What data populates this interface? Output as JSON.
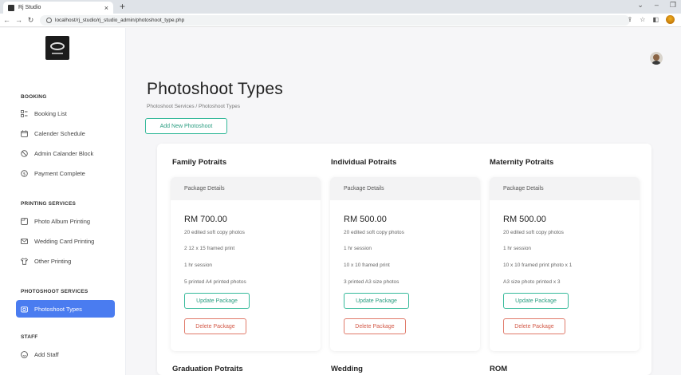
{
  "browser": {
    "tab_title": "Rj Studio",
    "tab_close": "×",
    "new_tab": "+",
    "url": "localhost/rj_studio/rj_studio_admin/photoshoot_type.php"
  },
  "sidebar": {
    "sections": [
      {
        "title": "BOOKING",
        "items": [
          "Booking List",
          "Calender Schedule",
          "Admin Calander Block",
          "Payment Complete"
        ]
      },
      {
        "title": "PRINTING SERVICES",
        "items": [
          "Photo Album Printing",
          "Wedding Card Printing",
          "Other Printing"
        ]
      },
      {
        "title": "PHOTOSHOOT SERVICES",
        "items": [
          "Photoshoot Types"
        ]
      },
      {
        "title": "STAFF",
        "items": [
          "Add Staff"
        ]
      }
    ],
    "active_item": "Photoshoot Types"
  },
  "page": {
    "title": "Photoshoot Types",
    "breadcrumb": "Photoshoot Services  /  Photoshoot Types",
    "add_button": "Add New Photoshoot"
  },
  "packages": [
    {
      "name": "Family Potraits",
      "header": "Package Details",
      "price": "RM 700.00",
      "details": [
        "20 edited soft copy photos",
        "2 12 x 15 framed print",
        "1 hr session",
        "5 printed A4 printed photos"
      ],
      "update": "Update Package",
      "delete": "Delete Package"
    },
    {
      "name": "Individual Potraits",
      "header": "Package Details",
      "price": "RM 500.00",
      "details": [
        "20 edited soft copy photos",
        "1 hr session",
        "10 x 10 framed print",
        "3 printed A3 size photos"
      ],
      "update": "Update Package",
      "delete": "Delete Package"
    },
    {
      "name": "Maternity Potraits",
      "header": "Package Details",
      "price": "RM 500.00",
      "details": [
        "20 edited soft copy photos",
        "1 hr session",
        "10 x 10 framed print photo x 1",
        "A3 size photo printed x 3"
      ],
      "update": "Update Package",
      "delete": "Delete Package"
    }
  ],
  "next_row_titles": [
    "Graduation Potraits",
    "Wedding",
    "ROM"
  ],
  "colors": {
    "accent": "#4a7cf0",
    "update": "#35b99a",
    "delete": "#e07a6a"
  }
}
